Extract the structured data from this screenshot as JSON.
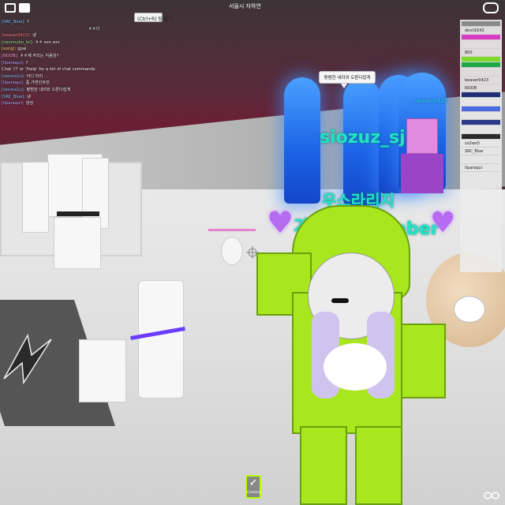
{
  "top_bar": {
    "title": "서울시 자하연",
    "chat_toggle_hint": "(Ctrl+R) 팀 알기"
  },
  "chat": {
    "lines": [
      {
        "name": "[SRC_Blue]:",
        "text": "?",
        "color": "#7ec8ff"
      },
      {
        "name": "",
        "text": "ㅎㅎ다",
        "color": "#e0e0e0"
      },
      {
        "name": "[beaver0423]:",
        "text": "넹",
        "color": "#ff7a7a"
      },
      {
        "name": "[neonnubo_lol]:",
        "text": "ㅎㅎ son soo",
        "color": "#8be88b"
      },
      {
        "name": "[song]:",
        "text": "gpal",
        "color": "#ffd36b"
      },
      {
        "name": "[NOOB]:",
        "text": "ㅎㅎ제 자리는 처음임?",
        "color": "#ff9bd2"
      },
      {
        "name": "[Ilparaqui]:",
        "text": "?",
        "color": "#b7a6ff"
      },
      {
        "name": "",
        "text": "Chat '/?' or '/help' for a list of chat commands.",
        "color": "#ffffff"
      },
      {
        "name": "[ssoora1u]:",
        "text": "어디 마리",
        "color": "#7ec8ff"
      },
      {
        "name": "[Ilparaqui]:",
        "text": "좀 가면인트만",
        "color": "#b7a6ff"
      },
      {
        "name": "[ssoora1u]:",
        "text": "평범한 내려와 오른다잡게",
        "color": "#7ec8ff"
      },
      {
        "name": "[SRC_Blue]:",
        "text": "넹",
        "color": "#7ec8ff"
      },
      {
        "name": "[Ilparaqui]:",
        "text": "엉엉",
        "color": "#b7a6ff"
      }
    ]
  },
  "leaderboard": {
    "rows": [
      {
        "label": "",
        "type": "team",
        "color": "#8a8a8a"
      },
      {
        "label": "devil1642",
        "type": "player"
      },
      {
        "label": "",
        "type": "team",
        "color": "#d83cc0"
      },
      {
        "label": "",
        "type": "player"
      },
      {
        "label": "800",
        "type": "player"
      },
      {
        "label": "",
        "type": "team",
        "color": "#7fd82c"
      },
      {
        "label": "",
        "type": "team",
        "color": "#1fa84a"
      },
      {
        "label": "",
        "type": "player"
      },
      {
        "label": "beaver0423",
        "type": "player"
      },
      {
        "label": "NOOB",
        "type": "player"
      },
      {
        "label": "",
        "type": "team",
        "color": "#1e2f78"
      },
      {
        "label": "",
        "type": "player"
      },
      {
        "label": "",
        "type": "team",
        "color": "#4a6ae0"
      },
      {
        "label": "",
        "type": "player"
      },
      {
        "label": "",
        "type": "team",
        "color": "#2a3a88"
      },
      {
        "label": "",
        "type": "player"
      },
      {
        "label": "",
        "type": "team",
        "color": "#2a2a2a"
      },
      {
        "label": "so2wx5",
        "type": "player"
      },
      {
        "label": "SRC_Blue",
        "type": "player"
      },
      {
        "label": "",
        "type": "player"
      },
      {
        "label": "Ilparaqui",
        "type": "player"
      }
    ]
  },
  "world": {
    "speech_bubble": "평범한 내려와 오른다잡게",
    "other_player_name": "beaver0423",
    "floating_name_1": "siozuz_sj",
    "floating_name_2": "우스라리지",
    "floating_name_3": "가입",
    "floating_name_4": "mber"
  },
  "hotbar": {
    "combat_label": "Combat"
  },
  "colors": {
    "accent_green": "#b6ff00",
    "name_cyan": "#22e3c8"
  }
}
